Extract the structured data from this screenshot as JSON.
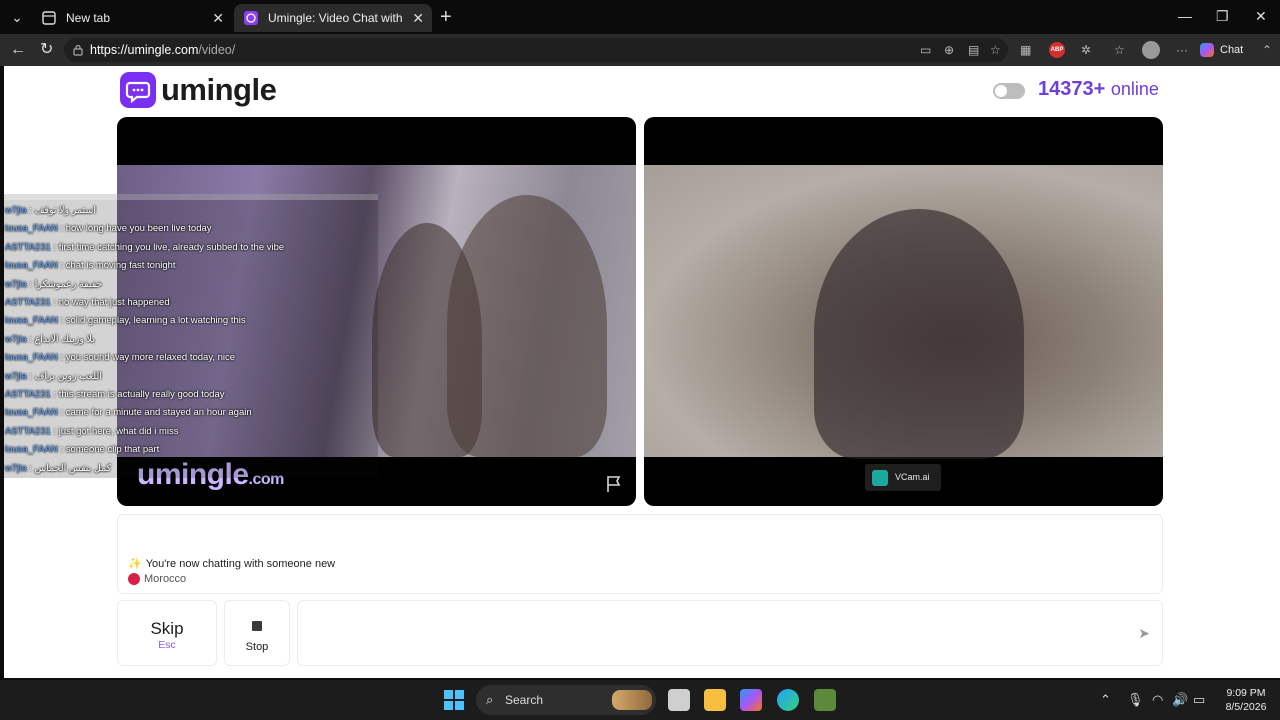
{
  "browser": {
    "tabs": [
      {
        "title": "New tab"
      },
      {
        "title": "Umingle: Video Chat with Stra"
      }
    ],
    "url_host": "https://umingle.com",
    "url_path": "/video/",
    "copilot_label": "Chat"
  },
  "header": {
    "brand": "umingle",
    "online_count": "14373+",
    "online_label": "online"
  },
  "video_left": {
    "watermark_main": "umingle",
    "watermark_tld": ".com",
    "chat_overlay": [
      {
        "user": "w7jla",
        "text": "استمر ولا توقف"
      },
      {
        "user": "lousa_FAAN",
        "text": "how long have you been live today"
      },
      {
        "user": "ASTTA231",
        "text": "first time catching you live, already subbed to the vibe"
      },
      {
        "user": "lousa_FAAN",
        "text": "chat is moving fast tonight"
      },
      {
        "user": "w7jla",
        "text": "خفيفة زعموشكرا"
      },
      {
        "user": "ASTTA231",
        "text": "no way that just happened"
      },
      {
        "user": "lousa_FAAN",
        "text": "solid gameplay, learning a lot watching this"
      },
      {
        "user": "w7jla",
        "text": "بلا وزبيك الابداع"
      },
      {
        "user": "lousa_FAAN",
        "text": "you sound way more relaxed today, nice"
      },
      {
        "user": "w7jla",
        "text": "اللعب زوين بزاف"
      },
      {
        "user": "ASTTA231",
        "text": "this stream is actually really good today"
      },
      {
        "user": "lousa_FAAN",
        "text": "came for a minute and stayed an hour again"
      },
      {
        "user": "ASTTA231",
        "text": "just got here, what did i miss"
      },
      {
        "user": "lousa_FAAN",
        "text": "someone clip that part"
      },
      {
        "user": "w7jla",
        "text": "كمل بنفس الحماس"
      }
    ]
  },
  "video_right": {
    "vcam_label": "VCam.ai"
  },
  "status": {
    "message": "You're now chatting with someone new",
    "country": "Morocco"
  },
  "controls": {
    "skip_label": "Skip",
    "skip_key": "Esc",
    "stop_label": "Stop",
    "message_placeholder": ""
  },
  "taskbar": {
    "search_label": "Search",
    "time": "9:09 PM",
    "date": "8/5/2026"
  }
}
